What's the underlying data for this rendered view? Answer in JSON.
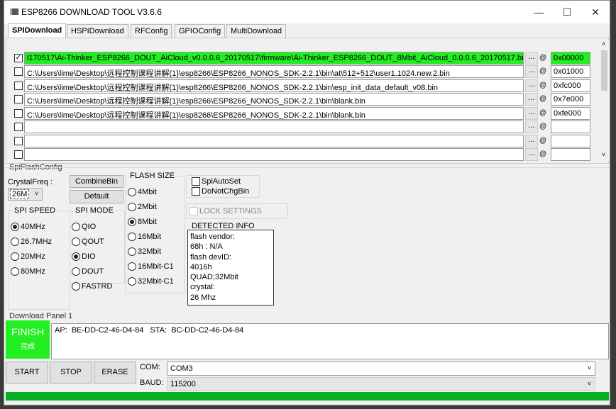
{
  "window": {
    "title": "ESP8266 DOWNLOAD TOOL V3.6.6",
    "min": "—",
    "max": "☐",
    "close": "✕"
  },
  "tabs": [
    "SPIDownload",
    "HSPIDownload",
    "RFConfig",
    "GPIOConfig",
    "MultiDownload"
  ],
  "files": [
    {
      "checked": true,
      "path": "l170517\\Ai-Thinker_ESP8266_DOUT_AiCloud_v0.0.0.6_20170517\\firmware\\Ai-Thinker_ESP8266_DOUT_8Mbit_AiCloud_0.0.0.6_20170517.bin",
      "addr": "0x00000"
    },
    {
      "checked": false,
      "path": "C:\\Users\\lime\\Desktop\\远程控制课程讲解(1)\\esp8266\\ESP8266_NONOS_SDK-2.2.1\\bin\\at\\512+512\\user1.1024.new.2.bin",
      "addr": "0x01000"
    },
    {
      "checked": false,
      "path": "C:\\Users\\lime\\Desktop\\远程控制课程讲解(1)\\esp8266\\ESP8266_NONOS_SDK-2.2.1\\bin\\esp_init_data_default_v08.bin",
      "addr": "0xfc000"
    },
    {
      "checked": false,
      "path": "C:\\Users\\lime\\Desktop\\远程控制课程讲解(1)\\esp8266\\ESP8266_NONOS_SDK-2.2.1\\bin\\blank.bin",
      "addr": "0x7e000"
    },
    {
      "checked": false,
      "path": "C:\\Users\\lime\\Desktop\\远程控制课程讲解(1)\\esp8266\\ESP8266_NONOS_SDK-2.2.1\\bin\\blank.bin",
      "addr": "0xfe000"
    },
    {
      "checked": false,
      "path": "",
      "addr": ""
    },
    {
      "checked": false,
      "path": "",
      "addr": ""
    },
    {
      "checked": false,
      "path": "",
      "addr": ""
    }
  ],
  "browse_label": "...",
  "at_label": "@",
  "spi": {
    "group": "SpiFlashConfig",
    "crystal_label": "CrystalFreq :",
    "crystal_value": "26M",
    "combine": "CombineBin",
    "default": "Default",
    "speed_label": "SPI SPEED",
    "speeds": [
      "40MHz",
      "26.7MHz",
      "20MHz",
      "80MHz"
    ],
    "speed_selected": 0,
    "mode_label": "SPI MODE",
    "modes": [
      "QIO",
      "QOUT",
      "DIO",
      "DOUT",
      "FASTRD"
    ],
    "mode_selected": 2,
    "size_label": "FLASH SIZE",
    "sizes": [
      "4Mbit",
      "2Mbit",
      "8Mbit",
      "16Mbit",
      "32Mbit",
      "16Mbit-C1",
      "32Mbit-C1"
    ],
    "size_selected": 2,
    "spiautoset": "SpiAutoSet",
    "donotchg": "DoNotChgBin",
    "lock": "LOCK SETTINGS",
    "detected_label": "DETECTED INFO",
    "detected": [
      "flash vendor:",
      "68h : N/A",
      "flash devID:",
      "4016h",
      "QUAD;32Mbit",
      "crystal:",
      "26 Mhz"
    ]
  },
  "download": {
    "label": "Download Panel 1",
    "status": "FINISH",
    "status_cn": "完成",
    "log": "AP:  BE-DD-C2-46-D4-84   STA:  BC-DD-C2-46-D4-84",
    "start": "START",
    "stop": "STOP",
    "erase": "ERASE",
    "com_label": "COM:",
    "com_value": "COM3",
    "baud_label": "BAUD:",
    "baud_value": "115200",
    "progress": 1.0
  },
  "colors": {
    "success": "#22ee22",
    "progress": "#06b025"
  }
}
